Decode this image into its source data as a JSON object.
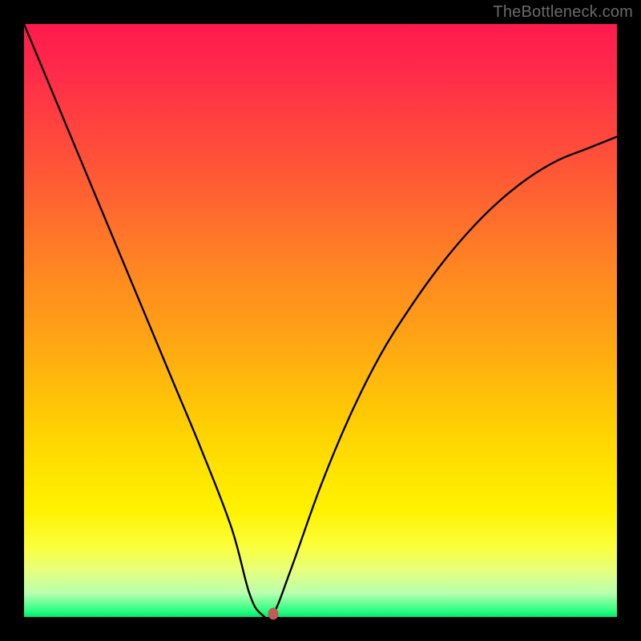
{
  "watermark": "TheBottleneck.com",
  "colors": {
    "frame": "#000000",
    "curve": "#000000",
    "marker": "#c25a55",
    "gradient_top": "#ff1a4d",
    "gradient_bottom": "#00e673"
  },
  "chart_data": {
    "type": "line",
    "title": "",
    "xlabel": "",
    "ylabel": "",
    "xlim": [
      0,
      100
    ],
    "ylim": [
      0,
      100
    ],
    "grid": false,
    "legend": false,
    "annotations": [
      "TheBottleneck.com"
    ],
    "series": [
      {
        "name": "bottleneck-curve",
        "x": [
          0,
          5,
          10,
          15,
          20,
          25,
          30,
          35,
          38,
          40,
          42,
          45,
          50,
          55,
          60,
          65,
          70,
          75,
          80,
          85,
          90,
          95,
          100
        ],
        "values": [
          100,
          88,
          76,
          64,
          52,
          40,
          28,
          15,
          4,
          0.5,
          0.5,
          8,
          22,
          34,
          44,
          52,
          59,
          65,
          70,
          74,
          77,
          79,
          81
        ]
      }
    ],
    "marker": {
      "x": 42,
      "y": 0.5
    },
    "background_gradient": {
      "direction": "vertical",
      "stops": [
        {
          "pos": 0.0,
          "color": "#ff1a4d"
        },
        {
          "pos": 0.5,
          "color": "#ff9c18"
        },
        {
          "pos": 0.82,
          "color": "#fff200"
        },
        {
          "pos": 1.0,
          "color": "#00e673"
        }
      ]
    }
  }
}
